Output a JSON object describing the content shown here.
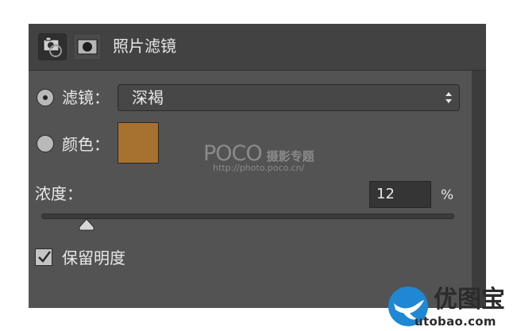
{
  "panel": {
    "title": "照片滤镜",
    "header_icons": [
      "photo-filter-adjustment-icon",
      "layer-mask-icon"
    ]
  },
  "filter_option": {
    "label": "滤镜：",
    "selected": true,
    "select_value": "深褐"
  },
  "color_option": {
    "label": "颜色：",
    "selected": false,
    "swatch_color": "#a7712f"
  },
  "density": {
    "label": "浓度：",
    "value": "12",
    "unit": "%",
    "slider_fraction": 0.12
  },
  "preserve_luminosity": {
    "label": "保留明度",
    "checked": true
  },
  "watermark": {
    "logo": "POCO",
    "subtitle": "摄影专题",
    "url": "http://photo.poco.cn/"
  },
  "brand": {
    "name": "优图宝",
    "url": "utobao.com",
    "logo_icon": "bird-icon"
  },
  "colors": {
    "panel_bg": "#535353",
    "header_bg": "#424242",
    "text": "#e8e8e8",
    "brand_blue": "#1e88d4"
  }
}
